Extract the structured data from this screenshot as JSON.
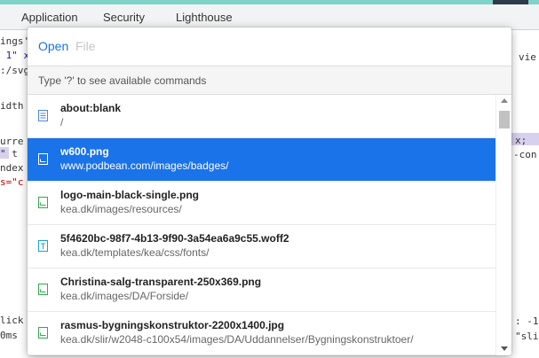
{
  "tabs": [
    "Application",
    "Security",
    "Lighthouse"
  ],
  "background_code": {
    "left": [
      "ings'",
      " 1\" x",
      ":/svg",
      "idth",
      "urre",
      "\" t",
      "ndex",
      "s=\"c",
      "lick",
      "0ms"
    ],
    "right": [
      "vie",
      "x;",
      "-con",
      ": -1",
      "\"sli"
    ]
  },
  "command_menu": {
    "prompt": "Open",
    "placeholder": "File",
    "help_text": "Type '?' to see available commands",
    "items": [
      {
        "title": "about:blank",
        "subtitle": "/",
        "icon": "document-icon",
        "selected": false
      },
      {
        "title": "w600.png",
        "subtitle": "www.podbean.com/images/badges/",
        "icon": "image-icon",
        "selected": true
      },
      {
        "title": "logo-main-black-single.png",
        "subtitle": "kea.dk/images/resources/",
        "icon": "image-icon",
        "selected": false
      },
      {
        "title": "5f4620bc-98f7-4b13-9f90-3a54ea6a9c55.woff2",
        "subtitle": "kea.dk/templates/kea/css/fonts/",
        "icon": "font-icon",
        "selected": false
      },
      {
        "title": "Christina-salg-transparent-250x369.png",
        "subtitle": "kea.dk/images/DA/Forside/",
        "icon": "image-icon",
        "selected": false
      },
      {
        "title": "rasmus-bygningskonstruktor-2200x1400.jpg",
        "subtitle": "kea.dk/slir/w2048-c100x54/images/DA/Uddannelser/Bygningskonstruktoer/",
        "icon": "image-icon",
        "selected": false
      }
    ]
  },
  "colors": {
    "accent": "#1a73e8",
    "doc_icon": "#4f86e8",
    "image_icon": "#34a853",
    "font_icon": "#1aa1d8"
  }
}
